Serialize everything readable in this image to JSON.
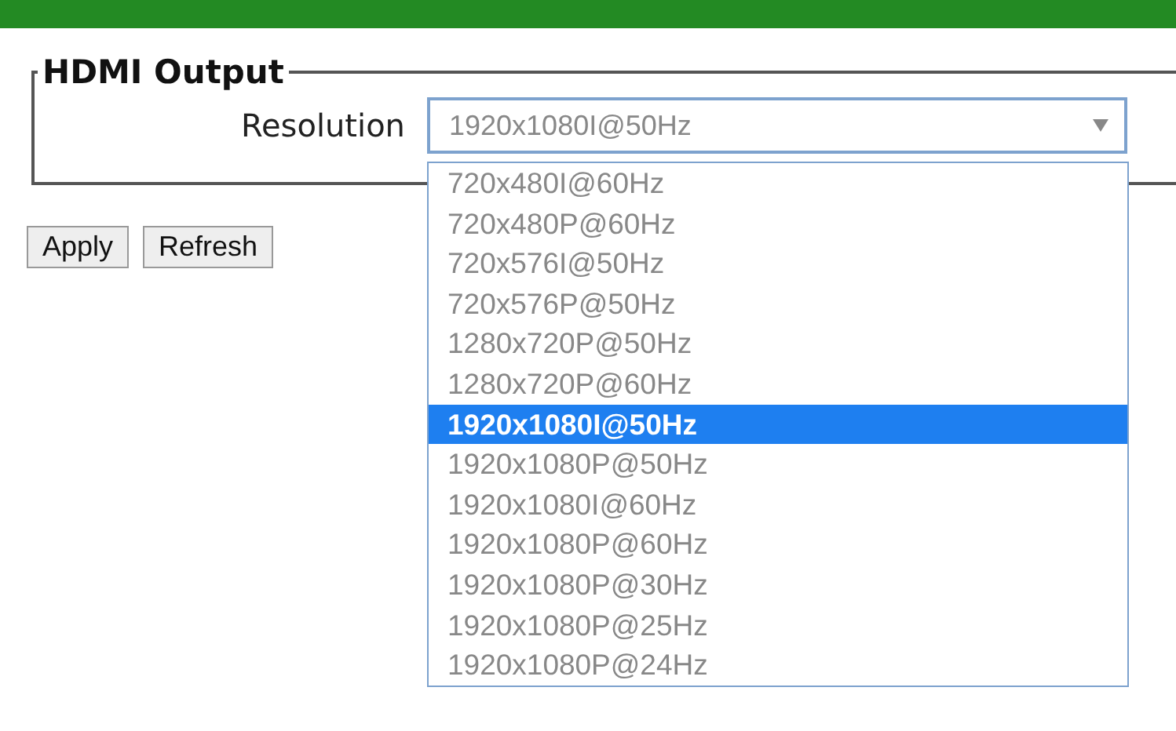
{
  "fieldset": {
    "legend": "HDMI Output",
    "field": {
      "label": "Resolution",
      "value": "1920x1080I@50Hz",
      "expanded": true,
      "options": [
        {
          "label": "720x480I@60Hz",
          "selected": false
        },
        {
          "label": "720x480P@60Hz",
          "selected": false
        },
        {
          "label": "720x576I@50Hz",
          "selected": false
        },
        {
          "label": "720x576P@50Hz",
          "selected": false
        },
        {
          "label": "1280x720P@50Hz",
          "selected": false
        },
        {
          "label": "1280x720P@60Hz",
          "selected": false
        },
        {
          "label": "1920x1080I@50Hz",
          "selected": true
        },
        {
          "label": "1920x1080P@50Hz",
          "selected": false
        },
        {
          "label": "1920x1080I@60Hz",
          "selected": false
        },
        {
          "label": "1920x1080P@60Hz",
          "selected": false
        },
        {
          "label": "1920x1080P@30Hz",
          "selected": false
        },
        {
          "label": "1920x1080P@25Hz",
          "selected": false
        },
        {
          "label": "1920x1080P@24Hz",
          "selected": false
        }
      ]
    }
  },
  "buttons": [
    "Apply",
    "Refresh"
  ]
}
